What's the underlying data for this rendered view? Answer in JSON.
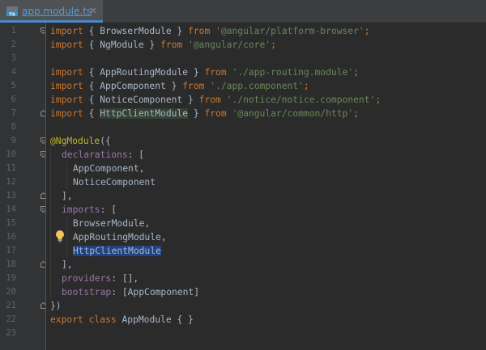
{
  "tab": {
    "icon_label": "TS",
    "file_name": "app.module.ts",
    "close_icon": "close-icon"
  },
  "editor": {
    "line_numbers": [
      "1",
      "2",
      "3",
      "4",
      "5",
      "6",
      "7",
      "8",
      "9",
      "10",
      "11",
      "12",
      "13",
      "14",
      "15",
      "16",
      "17",
      "18",
      "19",
      "20",
      "21",
      "22",
      "23"
    ],
    "lines": {
      "l1": {
        "kw1": "import",
        "p1": " { BrowserModule } ",
        "kw2": "from",
        "sp": " ",
        "s1": "'@angular/platform-browser'",
        "end": ";"
      },
      "l2": {
        "kw1": "import",
        "p1": " { NgModule } ",
        "kw2": "from",
        "sp": " ",
        "s1": "'@angular/core'",
        "end": ";"
      },
      "l4": {
        "kw1": "import",
        "p1": " { AppRoutingModule } ",
        "kw2": "from",
        "sp": " ",
        "s1": "'./app-routing.module'",
        "end": ";"
      },
      "l5": {
        "kw1": "import",
        "p1": " { AppComponent } ",
        "kw2": "from",
        "sp": " ",
        "s1": "'./app.component'",
        "end": ";"
      },
      "l6": {
        "kw1": "import",
        "p1": " { NoticeComponent } ",
        "kw2": "from",
        "sp": " ",
        "s1": "'./notice/notice.component'",
        "end": ";"
      },
      "l7": {
        "kw1": "import",
        "p0": " { ",
        "hl": "HttpClientModule",
        "p1": " } ",
        "kw2": "from",
        "sp": " ",
        "s1": "'@angular/common/http'",
        "end": ";"
      },
      "l9": {
        "ann": "@NgModule",
        "rest": "({"
      },
      "l10": {
        "prop": "declarations",
        "rest": ": ["
      },
      "l11": {
        "text": "AppComponent,"
      },
      "l12": {
        "text": "NoticeComponent"
      },
      "l13": {
        "text": "],"
      },
      "l14": {
        "prop": "imports",
        "rest": ": ["
      },
      "l15": {
        "text": "BrowserModule,"
      },
      "l16": {
        "text": "AppRoutingModule,"
      },
      "l17": {
        "sel": "HttpClientModule"
      },
      "l18": {
        "text": "],"
      },
      "l19": {
        "prop": "providers",
        "rest": ": [],"
      },
      "l20": {
        "prop": "bootstrap",
        "rest": ": [AppComponent]"
      },
      "l21": {
        "text": "})"
      },
      "l22": {
        "kw1": "export",
        "sp1": " ",
        "kw2": "class",
        "rest": " AppModule { }"
      }
    }
  },
  "colors": {
    "background": "#2b2b2b",
    "gutter": "#313335",
    "keyword": "#cc7832",
    "string": "#6a8759",
    "annotation": "#bbb529",
    "property": "#9876aa",
    "text": "#a9b7c6",
    "selection": "#214283",
    "tab_accent": "#4a88c7"
  },
  "icons": [
    "typescript-file-icon",
    "close-icon",
    "fold-marker-icon",
    "lightbulb-icon"
  ]
}
